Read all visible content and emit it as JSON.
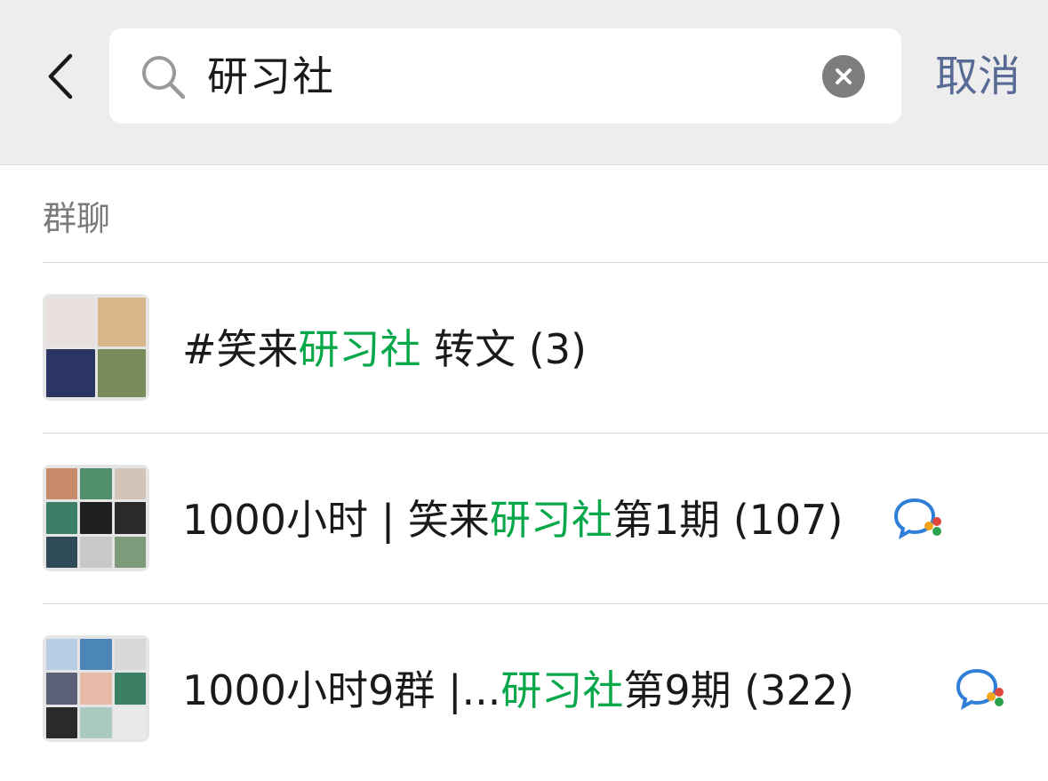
{
  "search": {
    "query": "研习社",
    "cancel_label": "取消"
  },
  "section": {
    "title": "群聊"
  },
  "results": [
    {
      "prefix": "#笑来",
      "highlight": "研习社",
      "suffix": " 转文 (3)",
      "has_chat_badge": false
    },
    {
      "prefix": "1000小时 | 笑来",
      "highlight": "研习社",
      "suffix": "第1期 (107)",
      "has_chat_badge": true
    },
    {
      "prefix": "1000小时9群 |...",
      "highlight": "研习社",
      "suffix": "第9期 (322)",
      "has_chat_badge": true
    }
  ],
  "colors": {
    "highlight": "#07a84a",
    "link": "#576b95",
    "header_bg": "#ededed"
  },
  "icons": {
    "back": "chevron-left-icon",
    "search": "search-icon",
    "clear": "clear-icon",
    "chat_badge": "chat-bubble-icon"
  }
}
